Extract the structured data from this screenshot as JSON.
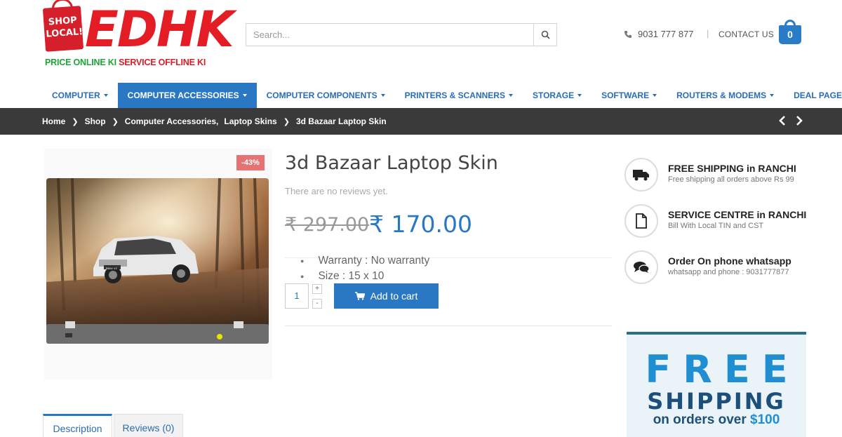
{
  "logo": {
    "bag_text": "SHOP LOCAL!",
    "word": "EDHK",
    "tagline_green": "PRICE ONLINE KI",
    "tagline_red": "SERVICE OFFLINE KI"
  },
  "search": {
    "placeholder": "Search..."
  },
  "header": {
    "phone": "9031 777 877",
    "separator": "|",
    "contact": "CONTACT US",
    "cart_count": "0"
  },
  "nav": [
    {
      "label": "COMPUTER",
      "active": false
    },
    {
      "label": "COMPUTER ACCESSORIES",
      "active": true
    },
    {
      "label": "COMPUTER COMPONENTS",
      "active": false
    },
    {
      "label": "PRINTERS & SCANNERS",
      "active": false
    },
    {
      "label": "STORAGE",
      "active": false
    },
    {
      "label": "SOFTWARE",
      "active": false
    },
    {
      "label": "ROUTERS & MODEMS",
      "active": false
    },
    {
      "label": "DEAL PAGE",
      "active": false,
      "no_caret": true
    }
  ],
  "breadcrumb": {
    "home": "Home",
    "shop": "Shop",
    "category1": "Computer Accessories,",
    "category2": "Laptop Skins",
    "current": "3d Bazaar Laptop Skin"
  },
  "product": {
    "sale_badge": "-43%",
    "title": "3d Bazaar Laptop Skin",
    "reviews": "There are no reviews yet.",
    "old_price": "₹ 297.00",
    "new_price": "₹ 170.00",
    "attributes": [
      "Warranty : No warranty",
      "Size : 15 x 10"
    ],
    "quantity": "1",
    "plus": "+",
    "minus": "-",
    "add_to_cart": "Add to cart",
    "car_plate": "BMW X3"
  },
  "tabs": {
    "description": "Description",
    "reviews": "Reviews (0)"
  },
  "features": [
    {
      "title": "FREE SHIPPING in RANCHI",
      "subtitle": "Free shipping all orders above  Rs 99",
      "icon": "truck-icon"
    },
    {
      "title": "SERVICE CENTRE in RANCHI",
      "subtitle": "Bill With Local TIN and CST",
      "icon": "document-icon"
    },
    {
      "title": "Order On phone whatsapp",
      "subtitle": "whatsapp and phone : 9031777877",
      "icon": "chat-icon"
    }
  ],
  "banner": {
    "line1": "FREE",
    "line2": "SHIPPING",
    "line3_prefix": "on orders over ",
    "line3_amount": "$100"
  },
  "colors": {
    "primary_blue": "#2a77c4",
    "logo_red": "#e41d25",
    "logo_green": "#1fa33a",
    "dark_bar": "#3a3a3a",
    "sale_badge": "#e57373"
  }
}
